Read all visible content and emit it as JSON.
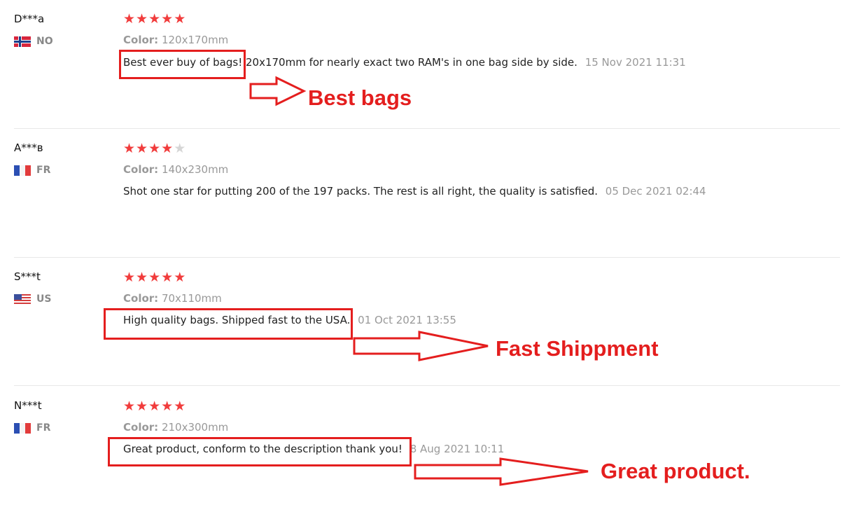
{
  "reviews": [
    {
      "user": "D***a",
      "country_code": "NO",
      "flag": "norway-flag",
      "rating": 5,
      "sku_label": "Color:",
      "sku_value": "120x170mm",
      "highlight_text": "Best ever buy of bags!",
      "rest_text": " 20x170mm for nearly exact two RAM's in one bag side by side.",
      "date": "15 Nov 2021 11:31",
      "annotation": "Best bags"
    },
    {
      "user": "A***в",
      "country_code": "FR",
      "flag": "france-flag",
      "rating": 4,
      "sku_label": "Color:",
      "sku_value": "140x230mm",
      "text": "Shot one star for putting 200 of the 197 packs. The rest is all right, the quality is satisfied.",
      "date": "05 Dec 2021 02:44"
    },
    {
      "user": "S***t",
      "country_code": "US",
      "flag": "usa-flag",
      "rating": 5,
      "sku_label": "Color:",
      "sku_value": "70x110mm",
      "highlight_text": "High quality bags. Shipped fast to the USA.",
      "date": "01 Oct 2021 13:55",
      "annotation": "Fast Shippment"
    },
    {
      "user": "N***t",
      "country_code": "FR",
      "flag": "france-flag",
      "rating": 5,
      "sku_label": "Color:",
      "sku_value": "210x300mm",
      "highlight_text": "Great product, conform to the description thank you!",
      "date": "8 Aug 2021 10:11",
      "annotation": "Great product."
    }
  ],
  "colors": {
    "star_active": "#f13c3c",
    "star_inactive": "#d6d6d6",
    "annotation_red": "#e41e1e",
    "muted_text": "#999999"
  }
}
